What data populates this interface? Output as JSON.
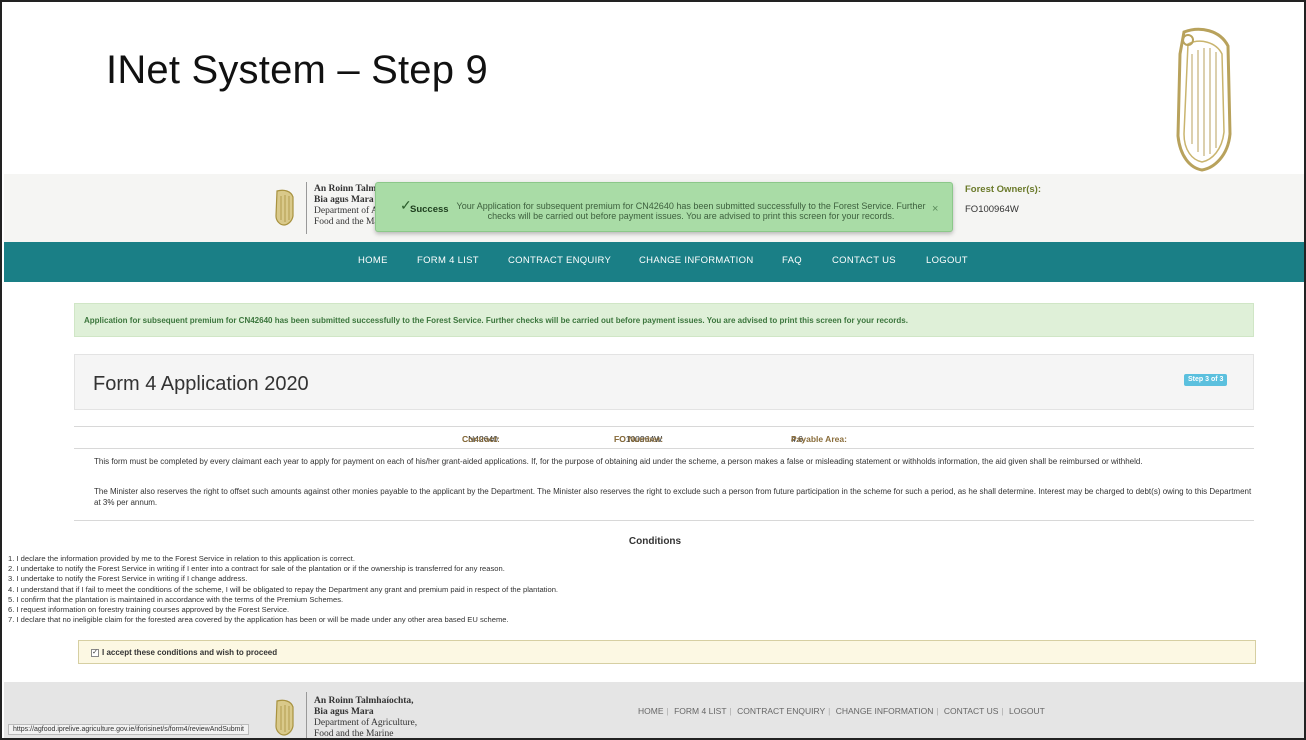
{
  "slide": {
    "title": "INet System – Step 9"
  },
  "header": {
    "dept_lines": [
      "An Roinn Talmhaíochta,",
      "Bia agus Mara",
      "Department of Agriculture,",
      "Food and the Marine"
    ],
    "owner_label": "Forest Owner(s):",
    "owner_value": "FO100964W"
  },
  "toast": {
    "title": "Success",
    "message": "Your Application for subsequent premium for CN42640 has been submitted successfully to the Forest Service. Further checks will be carried out before payment issues. You are advised to print this screen for your records.",
    "close": "×"
  },
  "nav": {
    "items": [
      "HOME",
      "FORM 4 LIST",
      "CONTRACT ENQUIRY",
      "CHANGE INFORMATION",
      "FAQ",
      "CONTACT US",
      "LOGOUT"
    ]
  },
  "alert": {
    "text": "Application for subsequent premium for CN42640 has been submitted successfully to the Forest Service. Further checks will be carried out before payment issues. You are advised to print this screen for your records."
  },
  "form": {
    "title": "Form 4 Application 2020",
    "step_badge": "Step 3 of 3"
  },
  "info": {
    "contract_label": "Contract:",
    "contract_value": "CN42640",
    "fo_label": "FO Number:",
    "fo_value": "FO100964W",
    "area_label": "Payable Area:",
    "area_value": "4.6"
  },
  "paragraphs": [
    "This form must be completed by every claimant each year to apply for payment on each of his/her grant-aided applications. If, for the purpose of obtaining aid under the scheme, a person makes a false or misleading statement or withholds information, the aid given shall be reimbursed or withheld.",
    "The Minister also reserves the right to offset such amounts against other monies payable to the applicant by the Department. The Minister also reserves the right to exclude such a person from future participation in the scheme for such a period, as he shall determine. Interest may be charged to debt(s) owing to this Department at 3% per annum."
  ],
  "conditions": {
    "title": "Conditions",
    "items": [
      "1.   I declare the information provided by me to the Forest Service in relation to this application is correct.",
      "2.   I undertake to notify the Forest Service in writing if I enter into a contract for sale of the plantation or if the ownership is transferred for any reason.",
      "3.   I undertake to notify the Forest Service in writing if I change address.",
      "4.   I understand that if I fail to meet the conditions of the scheme, I will be obligated to repay the Department any grant and premium paid in respect of the plantation.",
      "5.   I confirm that the plantation is maintained in accordance with the terms of the Premium Schemes.",
      "6.   I request information on forestry training courses approved by the Forest Service.",
      "7.   I declare that no ineligible claim for the forested area covered by the application has been or will be made under any other area based EU scheme."
    ]
  },
  "accept": {
    "checked": true,
    "label": "I accept these conditions and wish to proceed"
  },
  "footer": {
    "links": [
      "HOME",
      "FORM 4 LIST",
      "CONTRACT ENQUIRY",
      "CHANGE INFORMATION",
      "CONTACT US",
      "LOGOUT"
    ]
  },
  "status_url": "https://agfood.iprelive.agriculture.gov.ie/iforisinet/s/form4/reviewAndSubmit",
  "colors": {
    "nav_bg": "#1a7f86",
    "alert_bg": "#dff0d8",
    "toast_bg": "#a9dca6",
    "badge": "#5bc0de",
    "accept_bg": "#fcf8e3"
  }
}
